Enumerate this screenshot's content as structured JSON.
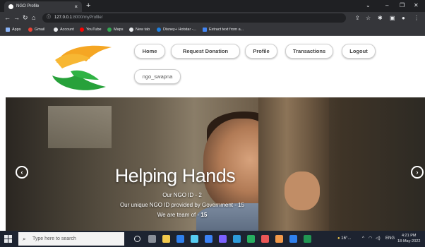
{
  "browser": {
    "tab_title": "NGO Profile",
    "tab_close": "×",
    "new_tab": "+",
    "url_host": "127.0.0.1",
    "url_rest": ":8000/myProfile/",
    "win_min": "–",
    "win_max": "❐",
    "win_close": "✕",
    "chevron": "⌄",
    "bookmarks": [
      {
        "label": "Apps",
        "color": "#8ab4f8"
      },
      {
        "label": "Gmail",
        "color": "#ea4335"
      },
      {
        "label": "Account",
        "color": "#e8eaed"
      },
      {
        "label": "YouTube",
        "color": "#ff0000"
      },
      {
        "label": "Maps",
        "color": "#34a853"
      },
      {
        "label": "New tab",
        "color": "#e8eaed"
      },
      {
        "label": "Disney+ Hotstar -...",
        "color": "#1f80e0"
      },
      {
        "label": "Extract text from a...",
        "color": "#4285f4"
      }
    ]
  },
  "nav": {
    "home": "Home",
    "request_donation": "Request Donation",
    "profile": "Profile",
    "transactions": "Transactions",
    "logout": "Logout",
    "username": "ngo_swapna"
  },
  "hero": {
    "headline": "Helping Hands",
    "ngo_id_label": "Our NGO ID - ",
    "ngo_id_value": "2",
    "gov_id_label": "Our unique NGO ID provided by Government - ",
    "gov_id_value": "15",
    "team_label": "We are team of - ",
    "team_value": "15",
    "prev_arrow": "‹",
    "next_arrow": "›"
  },
  "taskbar": {
    "search_placeholder": "Type here to search",
    "weather": "16°...",
    "lang": "ENG",
    "time": "4:21 PM",
    "date": "18-May-2022"
  },
  "colors": {
    "logo_orange": "#f5a623",
    "logo_green": "#27a13a",
    "chrome_dark": "#35363a"
  }
}
